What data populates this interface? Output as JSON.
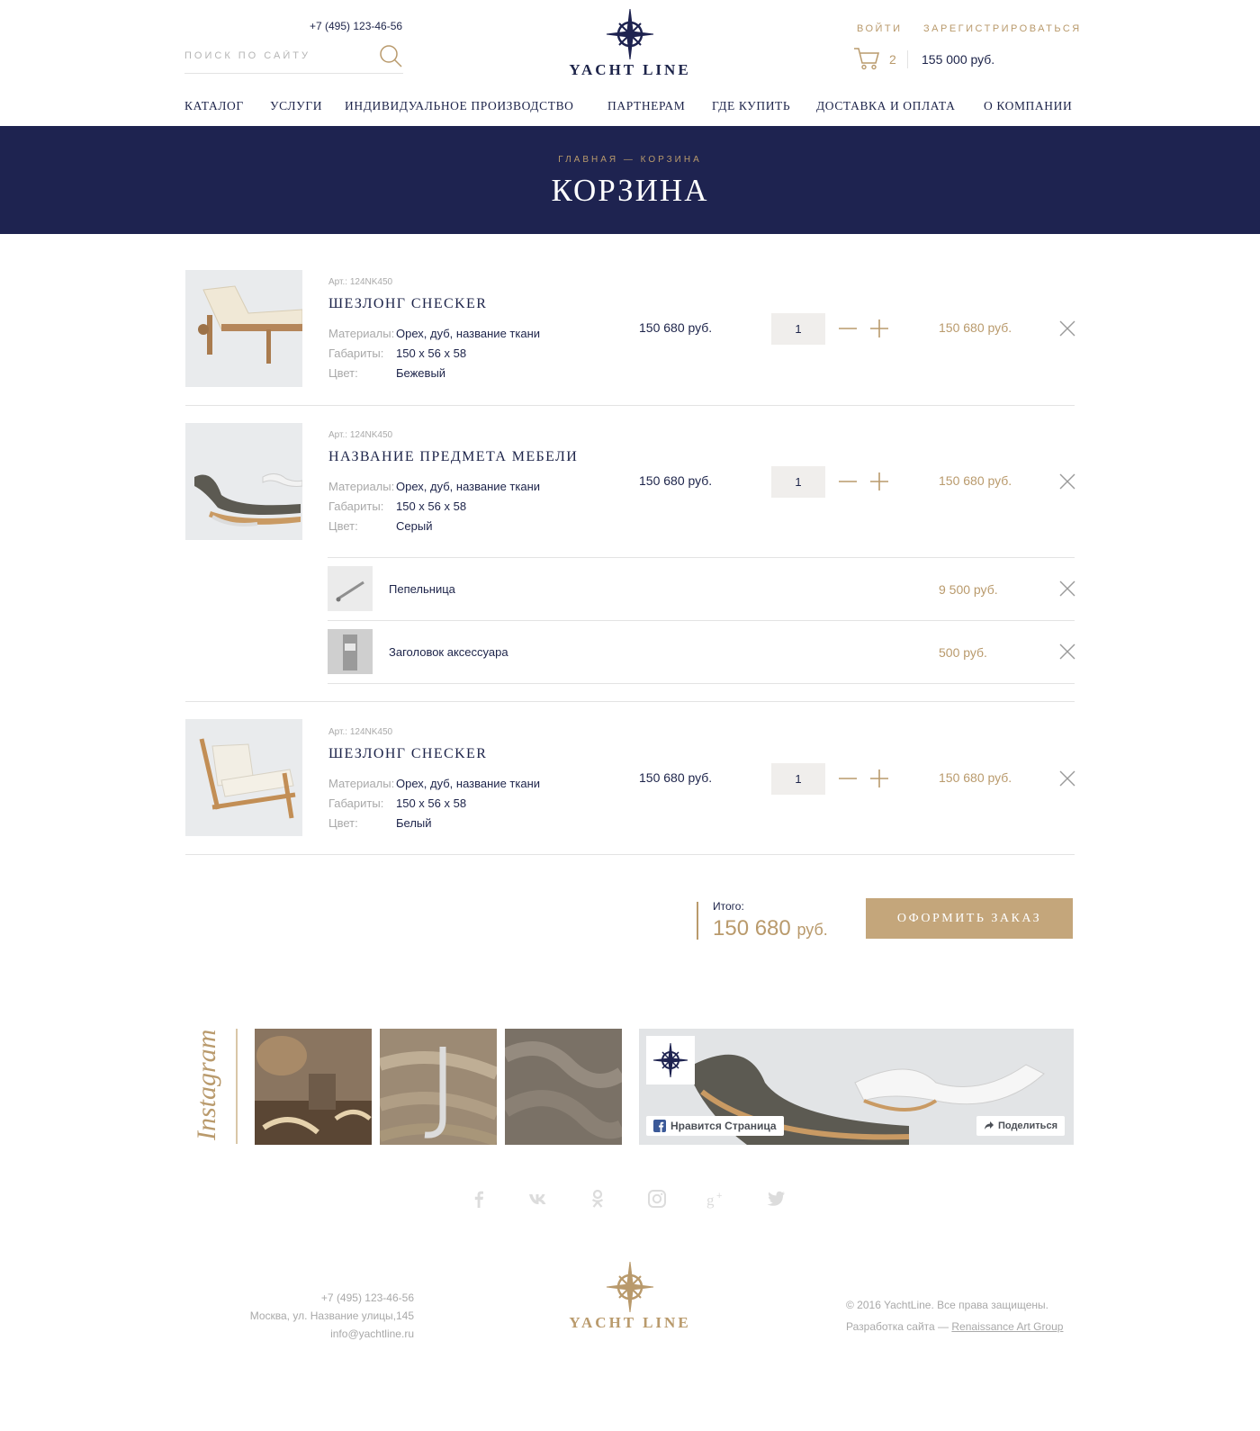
{
  "header": {
    "phone": "+7 (495) 123-46-56",
    "search_placeholder": "ПОИСК ПО САЙТУ",
    "logo_text": "YACHT LINE",
    "login": "ВОЙТИ",
    "register": "ЗАРЕГИСТРИРОВАТЬСЯ",
    "cart_count": "2",
    "cart_sum": "155 000 руб."
  },
  "nav": [
    "КАТАЛОГ",
    "УСЛУГИ",
    "ИНДИВИДУАЛЬНОЕ ПРОИЗВОДСТВО",
    "ПАРТНЕРАМ",
    "ГДЕ КУПИТЬ",
    "ДОСТАВКА И ОПЛАТА",
    "О КОМПАНИИ"
  ],
  "banner": {
    "breadcrumb": "ГЛАВНАЯ — КОРЗИНА",
    "title": "КОРЗИНА"
  },
  "cart": {
    "items": [
      {
        "sku": "Арт.: 124NK450",
        "name": "ШЕЗЛОНГ CHECKER",
        "materials_label": "Материалы:",
        "materials": "Орех, дуб, название ткани",
        "size_label": "Габариты:",
        "size": "150 х 56 х 58",
        "color_label": "Цвет:",
        "color": "Бежевый",
        "price": "150 680 руб.",
        "qty": "1",
        "total": "150 680 руб."
      },
      {
        "sku": "Арт.: 124NK450",
        "name": "НАЗВАНИЕ ПРЕДМЕТА МЕБЕЛИ",
        "materials_label": "Материалы:",
        "materials": "Орех, дуб, название ткани",
        "size_label": "Габариты:",
        "size": "150 х 56 х 58",
        "color_label": "Цвет:",
        "color": "Серый",
        "price": "150 680 руб.",
        "qty": "1",
        "total": "150 680 руб."
      },
      {
        "sku": "Арт.: 124NK450",
        "name": "ШЕЗЛОНГ CHECKER",
        "materials_label": "Материалы:",
        "materials": "Орех, дуб, название ткани",
        "size_label": "Габариты:",
        "size": "150 х 56 х 58",
        "color_label": "Цвет:",
        "color": "Белый",
        "price": "150 680 руб.",
        "qty": "1",
        "total": "150 680 руб."
      }
    ],
    "accessories": [
      {
        "name": "Пепельница",
        "price": "9 500 руб."
      },
      {
        "name": "Заголовок аксессуара",
        "price": "500 руб."
      }
    ],
    "total_label": "Итого:",
    "total_value": "150 680",
    "total_currency": "руб.",
    "order_button": "ОФОРМИТЬ ЗАКАЗ"
  },
  "instagram": {
    "label": "Instagram",
    "fb_like": "Нравится Страница",
    "fb_share": "Поделиться"
  },
  "social_icons": [
    "facebook-icon",
    "vk-icon",
    "odnoklassniki-icon",
    "instagram-icon",
    "google-plus-icon",
    "twitter-icon"
  ],
  "footer": {
    "phone": "+7 (495) 123-46-56",
    "address": "Москва, ул. Название улицы,145",
    "email": "info@yachtline.ru",
    "logo_text": "YACHT LINE",
    "copyright": "© 2016 YachtLine. Все права защищены.",
    "dev_prefix": "Разработка сайта —",
    "dev_link": "Renaissance Art Group"
  },
  "colors": {
    "navy": "#1e2350",
    "gold": "#b99a6c",
    "button": "#c4a67b"
  }
}
